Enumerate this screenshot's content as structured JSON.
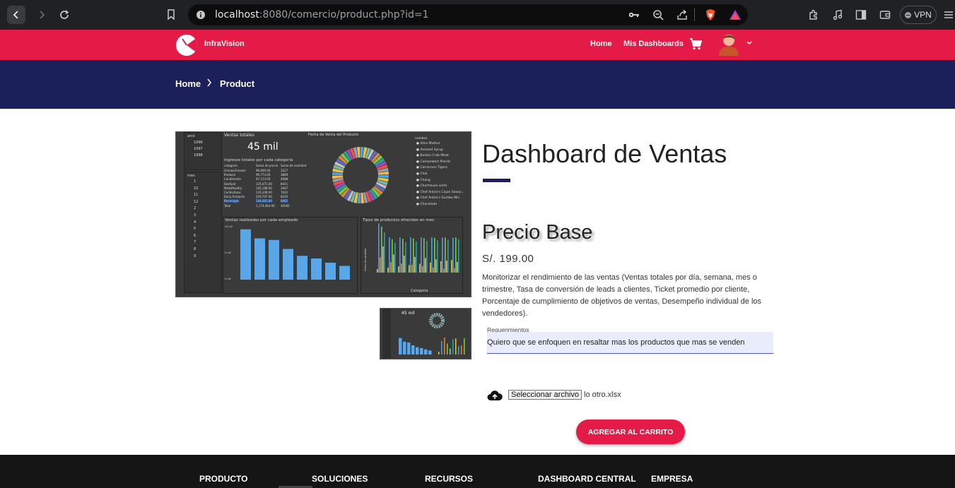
{
  "browser": {
    "url_host": "localhost",
    "url_rest": ":8080/comercio/product.php?id=1",
    "vpn_label": "VPN"
  },
  "header": {
    "brand": "InfraVision",
    "nav": [
      "Home",
      "Mis Dashboards"
    ]
  },
  "breadcrumb": {
    "home": "Home",
    "current": "Product"
  },
  "product": {
    "title": "Dashboard de Ventas",
    "price_title": "Precio Base",
    "price": "S/. 199.00",
    "description": "Monitorizar el rendimiento de las ventas (Ventas totales por día, semana, mes o trimestre, Tasa de conversión de leads a clientes, Ticket promedio por cliente, Porcentaje de cumplimiento de objetivos de ventas, Desempeño individual de los vendedores).",
    "requirements_label": "Requerimientos",
    "requirements_value": "Quiero que se enfoquen en resaltar mas los productos que mas se venden",
    "file_button": "Seleccionar archivo",
    "file_name": "lo otro.xlsx",
    "add_to_cart": "AGREGAR AL CARRITO"
  },
  "dashboard_image": {
    "anio_label": "anio",
    "years": [
      "1996",
      "1997",
      "1998"
    ],
    "mes_label": "mes",
    "months": [
      "1",
      "10",
      "11",
      "12",
      "2",
      "3",
      "4",
      "5",
      "6",
      "7",
      "8",
      "9"
    ],
    "kpi_title": "Ventas totales",
    "kpi_value": "45 mil",
    "donut_title": "Fecha de Venta del Producto",
    "table_title": "Ingresos totales por cada categoria",
    "table_headers": [
      "categoria",
      "Suma de precio",
      "Suma de cantidad"
    ],
    "table_rows": [
      [
        "Granos/Cereals",
        "96,849.00",
        "3317"
      ],
      [
        "Produce",
        "99,773.00",
        "3869"
      ],
      [
        "Condiments",
        "97,313.00",
        "4088"
      ],
      [
        "Seafood",
        "125,071.00",
        "8421"
      ],
      [
        "Meat/Poultry",
        "145,188.00",
        "3467"
      ],
      [
        "Confections",
        "135,349.00",
        "7042"
      ],
      [
        "Dairy Products",
        "229,707.00",
        "8220"
      ],
      [
        "Beverages",
        "244,463.00",
        "8462"
      ],
      [
        "Total",
        "1,174,464.00",
        "46282"
      ]
    ],
    "legend_title": "nombre",
    "legend_items": [
      "Alice Mutton",
      "Aniseed Syrup",
      "Boston Crab Meat",
      "Camembert Pierrot",
      "Carnarvon Tigers",
      "Chai",
      "Chang",
      "Chartreuse verte",
      "Chef Anton's Cajun Seaso...",
      "Chef Anton's Gumbo Mix",
      "Chocolade"
    ],
    "bar_chart_title": "Ventas realizadas por cada empleado",
    "bar_y_ticks": [
      "10 mil",
      "5 mil",
      "0 mil"
    ],
    "grouped_chart_title": "Tipos de productos ofrecidos en mes",
    "grouped_y_label": "Suma de cantidad",
    "grouped_x_label": "Categoria",
    "thumb_kpi": "45 mil"
  },
  "footer": {
    "headings": [
      "PRODUCTO",
      "SOLUCIONES",
      "RECURSOS",
      "DASHBOARD CENTRAL",
      "EMPRESA"
    ]
  }
}
